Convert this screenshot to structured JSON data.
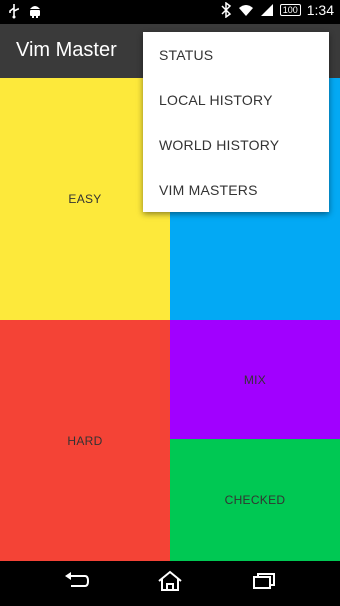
{
  "status_bar": {
    "time": "1:34",
    "battery": "100",
    "icons": [
      "usb-icon",
      "android-icon",
      "bluetooth-icon",
      "wifi-icon",
      "signal-icon",
      "battery-icon"
    ]
  },
  "app_bar": {
    "title": "Vim Master"
  },
  "tiles": [
    {
      "label": "EASY",
      "color": "#FDE93B"
    },
    {
      "label": "",
      "color": "#03A9F4"
    },
    {
      "label": "HARD",
      "color": "#F44336"
    },
    {
      "label": "MIX",
      "color": "#A100FF"
    },
    {
      "label": "CHECKED",
      "color": "#00C853"
    }
  ],
  "menu": {
    "items": [
      {
        "label": "STATUS"
      },
      {
        "label": "LOCAL HISTORY"
      },
      {
        "label": "WORLD HISTORY"
      },
      {
        "label": "VIM MASTERS"
      }
    ]
  },
  "nav_bar": {
    "icons": [
      "back-icon",
      "home-icon",
      "recent-apps-icon"
    ]
  }
}
